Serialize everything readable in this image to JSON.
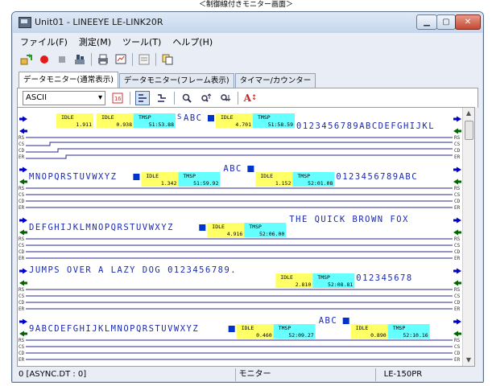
{
  "caption": "＜制御線付きモニター画面＞",
  "window": {
    "title": "Unit01 - LINEEYE LE-LINK20R",
    "buttons": [
      "minimize",
      "maximize",
      "close"
    ]
  },
  "menu": [
    "ファイル(F)",
    "測定(M)",
    "ツール(T)",
    "ヘルプ(H)"
  ],
  "toolbar": [
    "start-icon",
    "record-icon",
    "stop-icon",
    "trigger-icon",
    "print-icon",
    "monitor-icon",
    "config-icon"
  ],
  "tabs": [
    "データモニター(通常表示)",
    "データモニター(フレーム表示)",
    "タイマー/カウンター"
  ],
  "active_tab": 0,
  "subbar": {
    "code": "ASCII",
    "icons": [
      "hex-icon",
      "display-mode-icon",
      "split-icon",
      "search-icon",
      "search-up-icon",
      "search-down-icon",
      "font-icon"
    ]
  },
  "line_labels": [
    "RS",
    "CS",
    "CD",
    "ER"
  ],
  "rows": [
    {
      "top_text": "",
      "main_text": "",
      "main_text2": "",
      "marks": [
        {
          "tag": "IDLE",
          "value": "1.911",
          "color": "#ffff66"
        },
        {
          "tag": "IDLE",
          "value": "0.938",
          "color": "#ffff66"
        },
        {
          "tag": "TMSP",
          "value": "51:53.88",
          "color": "#66ffff"
        },
        {
          "tag": "IDLE",
          "value": "4.701",
          "color": "#ffff66"
        },
        {
          "tag": "TMSP",
          "value": "51:58.59",
          "color": "#66ffff"
        }
      ],
      "data": "ABC",
      "data2": "0123456789ABCDEFGHIJKL"
    },
    {
      "data": "MNOPQRSTUVWXYZ",
      "marks": [
        {
          "tag": "IDLE",
          "value": "1.342",
          "color": "#ffff66"
        },
        {
          "tag": "TMSP",
          "value": "51:59.92",
          "color": "#66ffff"
        },
        {
          "tag": "IDLE",
          "value": "1.152",
          "color": "#ffff66"
        },
        {
          "tag": "TMSP",
          "value": "52:01.08",
          "color": "#66ffff"
        }
      ],
      "data_mid": "ABC",
      "data2": "0123456789ABC"
    },
    {
      "data": "DEFGHIJKLMNOPQRSTUVWXYZ",
      "marks": [
        {
          "tag": "IDLE",
          "value": "4.916",
          "color": "#ffff66"
        },
        {
          "tag": "TMSP",
          "value": "52:06.00",
          "color": "#66ffff"
        }
      ],
      "data2": "THE QUICK BROWN FOX"
    },
    {
      "data": "JUMPS OVER A LAZY DOG 0123456789.",
      "marks": [
        {
          "tag": "IDLE",
          "value": "2.810",
          "color": "#ffff66"
        },
        {
          "tag": "TMSP",
          "value": "52:08.81",
          "color": "#66ffff"
        }
      ],
      "data2": "012345678"
    },
    {
      "data": "9ABCDEFGHIJKLMNOPQRSTUVWXYZ",
      "marks": [
        {
          "tag": "IDLE",
          "value": "0.460",
          "color": "#ffff66"
        },
        {
          "tag": "TMSP",
          "value": "52:09.27",
          "color": "#66ffff"
        },
        {
          "tag": "IDLE",
          "value": "0.890",
          "color": "#ffff66"
        },
        {
          "tag": "TMSP",
          "value": "52:10.16",
          "color": "#66ffff"
        }
      ],
      "data_mid": "ABC"
    }
  ],
  "status": {
    "position": "0 [ASYNC.DT : 0]",
    "mode": "モニター",
    "model": "LE-150PR"
  },
  "colors": {
    "data_text": "#1a2ab0",
    "idle_bg": "#ffff66",
    "tmsp_bg": "#66ffff",
    "arrow": "#0000cc",
    "arrow_green": "#006600",
    "ctrl_line": "#2a2a8a"
  }
}
